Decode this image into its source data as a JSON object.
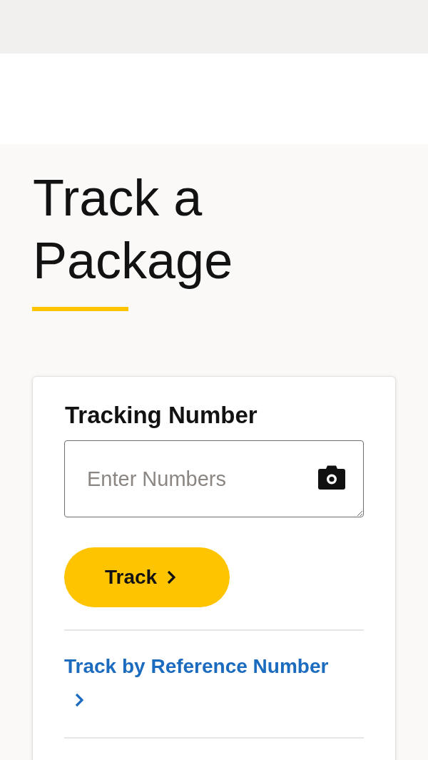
{
  "heading": {
    "title": "Track a Package"
  },
  "tracking_card": {
    "label": "Tracking Number",
    "input": {
      "placeholder": "Enter Numbers"
    },
    "button": {
      "label": "Track"
    },
    "links": [
      {
        "label": "Track by Reference Number"
      }
    ]
  }
}
